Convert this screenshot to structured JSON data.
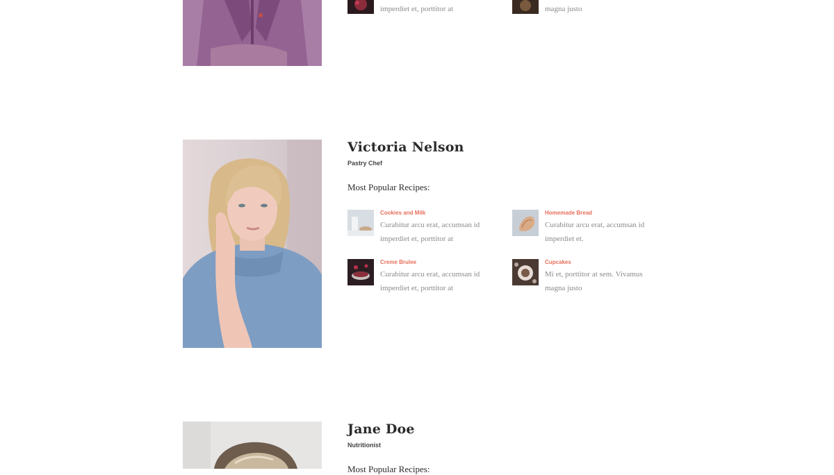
{
  "chefs": [
    {
      "name": "",
      "role": "",
      "recipes": [
        {
          "title": "",
          "desc": "imperdiet et, porttitor at"
        },
        {
          "title": "",
          "desc": "magna justo"
        }
      ]
    },
    {
      "name": "Victoria Nelson",
      "role": "Pastry Chef",
      "popular_heading": "Most Popular Recipes:",
      "recipes": [
        {
          "title": "Cookies and Milk",
          "desc": "Curabitur arcu erat, accumsan id imperdiet et, porttitor at",
          "thumb_icon": "cookies-milk-photo"
        },
        {
          "title": "Homemade Bread",
          "desc": "Curabitur arcu erat, accumsan id imperdiet et.",
          "thumb_icon": "bread-photo"
        },
        {
          "title": "Creme Brulee",
          "desc": "Curabitur arcu erat, accumsan id imperdiet et, porttitor at",
          "thumb_icon": "creme-brulee-photo"
        },
        {
          "title": "Cupcakes",
          "desc": "Mi et, porttitor at sem. Vivamus magna justo",
          "thumb_icon": "cupcakes-photo"
        }
      ]
    },
    {
      "name": "Jane Doe",
      "role": "Nutritionist",
      "popular_heading": "Most Popular Recipes:"
    }
  ],
  "colors": {
    "accent": "#e76f5b",
    "text": "#2b2b2b",
    "muted": "#8a8a8a"
  }
}
